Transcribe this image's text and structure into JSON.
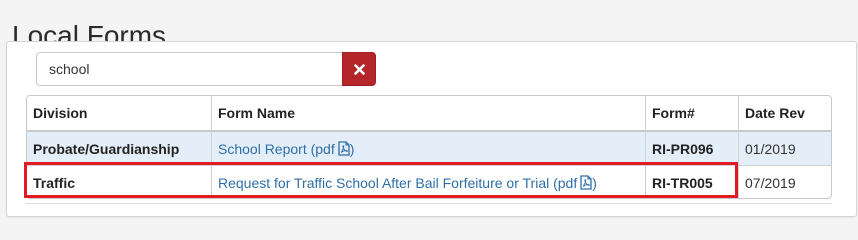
{
  "page": {
    "title": "Local Forms"
  },
  "search": {
    "value": "school",
    "clear_label": "×"
  },
  "table": {
    "columns": [
      "Division",
      "Form Name",
      "Form#",
      "Date Rev"
    ],
    "rows": [
      {
        "division": "Probate/Guardianship",
        "form_name": "School Report (pdf",
        "form_number": "RI-PR096",
        "date_rev": "01/2019",
        "highlighted": false
      },
      {
        "division": "Traffic",
        "form_name": "Request for Traffic School After Bail Forfeiture or Trial (pdf",
        "form_number": "RI-TR005",
        "date_rev": "07/2019",
        "highlighted": true
      }
    ]
  },
  "colors": {
    "clear_button": "#b5262b",
    "link": "#2f6fa8",
    "row_highlight_bg": "#e4eef8",
    "annotation_box": "#e01b24"
  },
  "icons": {
    "clear": "close-icon",
    "pdf": "pdf-file-icon"
  }
}
